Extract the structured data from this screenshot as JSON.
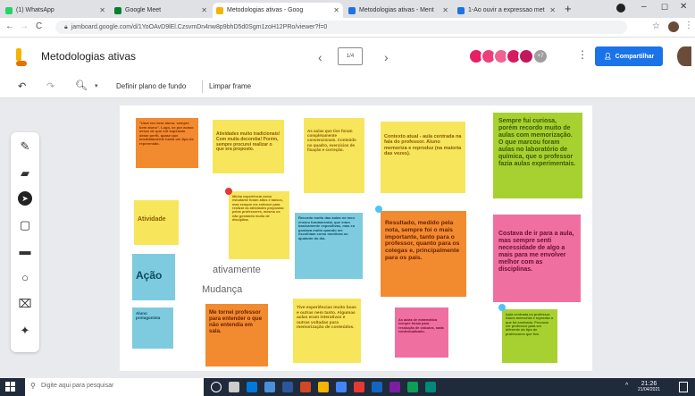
{
  "tabs": [
    {
      "label": "(1) WhatsApp",
      "color": "#25d366"
    },
    {
      "label": "Google Meet",
      "color": "#00832d"
    },
    {
      "label": "Metodologias ativas - Goog",
      "color": "#f4b400"
    },
    {
      "label": "Metodologias ativas - Ment",
      "color": "#1a73e8"
    },
    {
      "label": "1-Ao ouvir a expressao met",
      "color": "#1a73e8"
    }
  ],
  "address": {
    "url": "jamboard.google.com/d/1YoOAvD9lEl.CzsvmDn4nw8p9bhD5d0Sgm1zoH12PRo/viewer?f=0"
  },
  "app": {
    "title": "Metodologias ativas",
    "frame_indicator": "1/4",
    "share_label": "Compartilhar",
    "avatar_count": "+7"
  },
  "toolbar": {
    "set_background": "Definir plano de fundo",
    "clear_frame": "Limpar frame"
  },
  "board": {
    "text_ativamente": "ativamente",
    "text_mudanca": "Mudança",
    "notes": [
      {
        "id": "n1",
        "text": "\"Uma vez bem aluno, sempre bem aluno\". Logo, se por acaso sesse de que era superado deste perfil, quase que imediatamente havia um tipo de repreensão.",
        "color": "#f28b30"
      },
      {
        "id": "n2",
        "text": "Atividades muito tradicionais! Com muita decoreba! Porém, sempre procurei realizar o que era proposto.",
        "color": "#f7e55c"
      },
      {
        "id": "n3",
        "text": "As aulas que tive foram completamente convencionais. Conteúdo no quadro, exercícios de fixação e correção.",
        "color": "#f7e55c"
      },
      {
        "id": "n4",
        "text": "Contexto atual - aula centrada na fala do professor. Aluno memoriza e reproduz (na maioria das vezes).",
        "color": "#f7e55c"
      },
      {
        "id": "n5",
        "text": "Sempre fui curiosa, porém recordo muito de aulas com memorização. O que marcou foram aulas no laboratório de química, que o professor fazia aulas experimentais.",
        "color": "#a7d130"
      },
      {
        "id": "n6",
        "text": "Atividade",
        "color": "#f7e55c"
      },
      {
        "id": "n7",
        "text": "Minha experiência como estudante foram altos e baixos, mas sempre me esforcei para realizar as atividades propostas pelos professores, mesmo os não gostando muito de disciplina.",
        "color": "#f7e55c"
      },
      {
        "id": "n8",
        "text": "Recordo muito das aulas no meu ensino fundamental, que eram basicamente expositivas, mas eu gostava muito quando me escolhiam como monitora ou ajudante do dia.",
        "color": "#7ecbe0"
      },
      {
        "id": "n9",
        "text": "Resultado, medido pela nota, sempre foi o mais importante, tanto para o professor, quanto para os colegas e, principalmente para os pais.",
        "color": "#f28b30"
      },
      {
        "id": "n10",
        "text": "Costava de ir para a aula, mas sempre senti necessidade de algo a mais para me envolver melhor com as disciplinas.",
        "color": "#ef6fa1"
      },
      {
        "id": "n11",
        "text": "Ação",
        "color": "#7ecbe0"
      },
      {
        "id": "n12",
        "text": "Aluno protagonista",
        "color": "#7ecbe0"
      },
      {
        "id": "n13",
        "text": "Me tornei professor para entender o que não entendia em sala.",
        "color": "#f28b30"
      },
      {
        "id": "n14",
        "text": "Tive experiências muito boas e outras nem tanto. Algumas aulas eram interativas e outras voltadas para memorização de conteúdos.",
        "color": "#f7e55c"
      },
      {
        "id": "n15",
        "text": "As aulas de matemática sempre foram para resolução de cálculos, nada contextualizado.",
        "color": "#ef6fa1"
      },
      {
        "id": "n16",
        "text": "Aula centrada no professor. Aluno memoriza e reproduz o que foi ensinado. Procurar ser professor para ser diferente do tipo de professores que tive.",
        "color": "#a7d130"
      }
    ]
  },
  "taskbar": {
    "search_placeholder": "Digite aqui para pesquisar",
    "time": "21:26",
    "date": "21/04/2021"
  },
  "colors": {
    "accent": "#1a73e8",
    "jamboard_orange": "#f4b400"
  }
}
